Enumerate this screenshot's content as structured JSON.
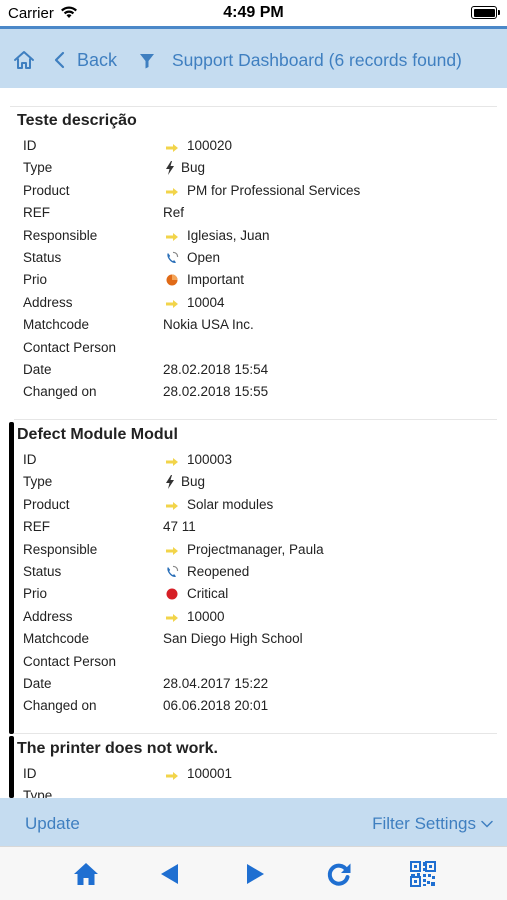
{
  "status_bar": {
    "carrier": "Carrier",
    "time": "4:49 PM"
  },
  "nav": {
    "back_label": "Back",
    "title": "Support Dashboard (6 records found)"
  },
  "records": [
    {
      "title": "Teste descrição",
      "fields": [
        {
          "label": "ID",
          "value": "100020",
          "icon": "arrow-icon"
        },
        {
          "label": "Type",
          "value": "Bug",
          "icon": "bolt-icon"
        },
        {
          "label": "Product",
          "value": "PM for Professional Services",
          "icon": "arrow-icon"
        },
        {
          "label": "REF",
          "value": "Ref",
          "icon": ""
        },
        {
          "label": "Responsible",
          "value": "Iglesias, Juan",
          "icon": "arrow-icon"
        },
        {
          "label": "Status",
          "value": "Open",
          "icon": "phone-status-icon"
        },
        {
          "label": "Prio",
          "value": "Important",
          "icon": "orange-priority-icon"
        },
        {
          "label": "Address",
          "value": "10004",
          "icon": "arrow-icon"
        },
        {
          "label": "Matchcode",
          "value": "Nokia USA Inc.",
          "icon": ""
        },
        {
          "label": "Contact Person",
          "value": "",
          "icon": ""
        },
        {
          "label": "Date",
          "value": "28.02.2018 15:54",
          "icon": ""
        },
        {
          "label": "Changed on",
          "value": "28.02.2018 15:55",
          "icon": ""
        }
      ]
    },
    {
      "title": "Defect Module Modul",
      "fields": [
        {
          "label": "ID",
          "value": "100003",
          "icon": "arrow-icon"
        },
        {
          "label": "Type",
          "value": "Bug",
          "icon": "bolt-icon"
        },
        {
          "label": "Product",
          "value": "Solar modules",
          "icon": "arrow-icon"
        },
        {
          "label": "REF",
          "value": "47 11",
          "icon": ""
        },
        {
          "label": "Responsible",
          "value": "Projectmanager, Paula",
          "icon": "arrow-icon"
        },
        {
          "label": "Status",
          "value": "Reopened",
          "icon": "phone-reopen-icon"
        },
        {
          "label": "Prio",
          "value": "Critical",
          "icon": "red-priority-icon"
        },
        {
          "label": "Address",
          "value": "10000",
          "icon": "arrow-icon"
        },
        {
          "label": "Matchcode",
          "value": "San Diego High School",
          "icon": ""
        },
        {
          "label": "Contact Person",
          "value": "",
          "icon": ""
        },
        {
          "label": "Date",
          "value": "28.04.2017 15:22",
          "icon": ""
        },
        {
          "label": "Changed on",
          "value": "06.06.2018 20:01",
          "icon": ""
        }
      ]
    },
    {
      "title": "The printer does not work.",
      "fields": [
        {
          "label": "ID",
          "value": "100001",
          "icon": "arrow-icon"
        },
        {
          "label": "Type",
          "value": "",
          "icon": ""
        }
      ]
    }
  ],
  "toolbar": {
    "update_label": "Update",
    "filter_label": "Filter Settings"
  },
  "tabs": [
    "home-icon",
    "previous-icon",
    "next-icon",
    "refresh-icon",
    "qr-code-icon"
  ],
  "colors": {
    "accent": "#3f7fc0",
    "nav_bg": "#c5dcf0",
    "arrow": "#f2d44a"
  }
}
